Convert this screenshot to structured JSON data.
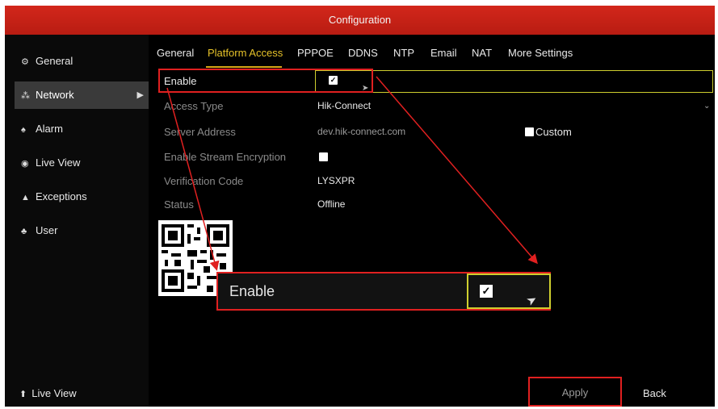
{
  "window": {
    "title": "Configuration"
  },
  "sidebar": {
    "items": [
      {
        "label": "General",
        "icon": "gear-icon"
      },
      {
        "label": "Network",
        "icon": "network-icon",
        "active": true
      },
      {
        "label": "Alarm",
        "icon": "alarm-icon"
      },
      {
        "label": "Live View",
        "icon": "eye-icon"
      },
      {
        "label": "Exceptions",
        "icon": "warning-icon"
      },
      {
        "label": "User",
        "icon": "users-icon"
      }
    ],
    "bottom_label": "Live View"
  },
  "tabs": [
    "General",
    "Platform Access",
    "PPPOE",
    "DDNS",
    "NTP",
    "Email",
    "NAT",
    "More Settings"
  ],
  "active_tab": "Platform Access",
  "form": {
    "enable": {
      "label": "Enable",
      "checked": true
    },
    "access_type": {
      "label": "Access Type",
      "value": "Hik-Connect"
    },
    "server_address": {
      "label": "Server Address",
      "value": "dev.hik-connect.com",
      "custom_label": "Custom"
    },
    "stream_encryption": {
      "label": "Enable Stream Encryption"
    },
    "verification_code": {
      "label": "Verification Code",
      "value": "LYSXPR"
    },
    "status": {
      "label": "Status",
      "value": "Offline"
    }
  },
  "popup": {
    "label": "Enable",
    "checked": true
  },
  "buttons": {
    "apply": "Apply",
    "back": "Back"
  },
  "colors": {
    "accent_red": "#e02020",
    "title_red": "#c4231a",
    "tab_active": "#e6c229",
    "field_outline": "#cfcf2e"
  }
}
